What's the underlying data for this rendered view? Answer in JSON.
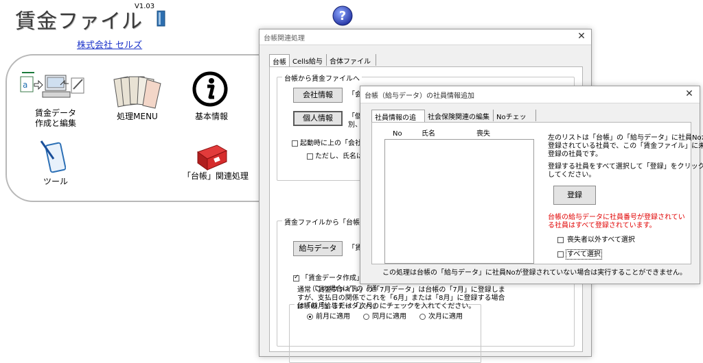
{
  "app": {
    "title": "賃金ファイル",
    "version": "V1.03",
    "company_link": "株式会社 セルズ"
  },
  "launcher": {
    "items": [
      {
        "label_line1": "賃金データ",
        "label_line2": "作成と編集"
      },
      {
        "label_line1": "処理MENU",
        "label_line2": ""
      },
      {
        "label_line1": "基本情報",
        "label_line2": ""
      },
      {
        "label_line1": "ツール",
        "label_line2": ""
      },
      {
        "label_line1": "「台帳」関連処理",
        "label_line2": ""
      }
    ]
  },
  "dialog1": {
    "title": "台帳関連処理",
    "close": "✕",
    "tabs": [
      "台帳",
      "Cells給与",
      "合体ファイル"
    ],
    "group1": {
      "legend": "台帳から賃金ファイルへ",
      "company_button": "会社情報",
      "company_desc": "「会社",
      "personal_button": "個人情報",
      "personal_desc_1": "「個人",
      "personal_desc_2": "別、社",
      "startup_checkbox": "起動時に上の「会社情",
      "name_checkbox": "ただし、氏名は同"
    },
    "group2": {
      "legend": "賃金ファイルから「台帳」給与",
      "payroll_button": "給与データ",
      "payroll_desc": "「賃金",
      "create_checkbox": "「賃金データ作成」の",
      "note": "（この場合は下の「通",
      "sub_group": {
        "legend": "台帳の「給与データ」への",
        "text_1": "通常「賃金ファイル」の「7月データ」は台帳の「7月」に登録しま",
        "text_2": "すが、支払日の関係でこれを「6月」または「8月」に登録する場合",
        "text_3": "は「前月」または「次月」にチェックを入れてください。",
        "radios": [
          "前月に適用",
          "同月に適用",
          "次月に適用"
        ]
      }
    }
  },
  "dialog2": {
    "title": "台帳（給与データ）の社員情報追加",
    "close": "✕",
    "tabs": [
      "社員情報の追加",
      "社会保険関連の編集",
      "Noチェック"
    ],
    "columns": [
      "No",
      "氏名",
      "喪失"
    ],
    "info_1": "左のリストは「台帳」の「給与データ」に社員Noが",
    "info_2": "登録されている社員で、この「賃金ファイル」に未",
    "info_3": "登録の社員です。",
    "instruction_1": "登録する社員をすべて選択して「登録」をクリック",
    "instruction_2": "してください。",
    "register_button": "登録",
    "warning_1": "台帳の給与データに社員番号が登録されてい",
    "warning_2": "る社員はすべて登録されています。",
    "select_except_lost": "喪失者以外すべて選択",
    "select_all": "すべて選択",
    "footer": "この処理は台帳の「給与データ」に社員Noが登録されていない場合は実行することができません。"
  },
  "colors": {
    "link": "#1b33c9",
    "warning": "#e00000",
    "help_icon": "#1f2fa0"
  }
}
